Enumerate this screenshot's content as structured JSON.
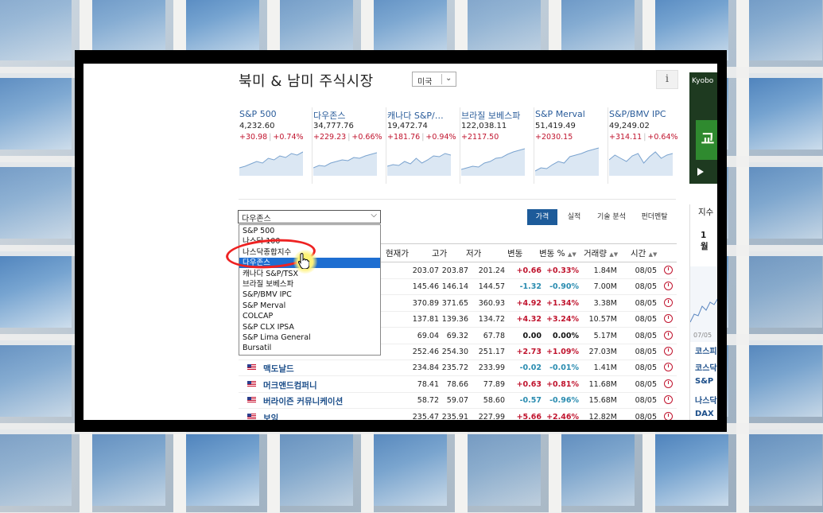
{
  "page": {
    "title": "북미 & 남미 주식시장",
    "region_select": "미국",
    "info_label": "i"
  },
  "indices": [
    {
      "name": "S&P 500",
      "value": "4,232.60",
      "change": "+30.98",
      "pct": "+0.74%"
    },
    {
      "name": "다우존스",
      "value": "34,777.76",
      "change": "+229.23",
      "pct": "+0.66%"
    },
    {
      "name": "캐나다 S&P/…",
      "value": "19,472.74",
      "change": "+181.76",
      "pct": "+0.94%"
    },
    {
      "name": "브라질 보베스파",
      "value": "122,038.11",
      "change": "+2117.50",
      "pct": ""
    },
    {
      "name": "S&P Merval",
      "value": "51,419.49",
      "change": "+2030.15",
      "pct": ""
    },
    {
      "name": "S&P/BMV IPC",
      "value": "49,249.02",
      "change": "+314.11",
      "pct": "+0.64%"
    }
  ],
  "view_tabs": [
    "가격",
    "실적",
    "기술 분석",
    "펀더멘탈"
  ],
  "index_select": {
    "value": "다우존스",
    "options": [
      "S&P 500",
      "나스닥 100",
      "나스닥종합지수",
      "다우존스",
      "캐나다 S&P/TSX",
      "브라질 보베스파",
      "S&P/BMV IPC",
      "S&P Merval",
      "COLCAP",
      "S&P CLX IPSA",
      "S&P Lima General",
      "Bursatil"
    ],
    "selected_index": 3
  },
  "table": {
    "headers": [
      "현재가",
      "고가",
      "저가",
      "변동",
      "변동 %",
      "거래량",
      "시간"
    ],
    "rows": [
      {
        "name": "",
        "last": "203.07",
        "high": "203.87",
        "low": "201.24",
        "chg": "+0.66",
        "pct": "+0.33%",
        "vol": "1.84M",
        "time": "08/05",
        "dir": "up"
      },
      {
        "name": "",
        "last": "145.46",
        "high": "146.14",
        "low": "144.57",
        "chg": "-1.32",
        "pct": "-0.90%",
        "vol": "7.00M",
        "time": "08/05",
        "dir": "down"
      },
      {
        "name": "",
        "last": "370.89",
        "high": "371.65",
        "low": "360.93",
        "chg": "+4.92",
        "pct": "+1.34%",
        "vol": "3.38M",
        "time": "08/05",
        "dir": "up"
      },
      {
        "name": "",
        "last": "137.81",
        "high": "139.36",
        "low": "134.72",
        "chg": "+4.32",
        "pct": "+3.24%",
        "vol": "10.57M",
        "time": "08/05",
        "dir": "up"
      },
      {
        "name": "",
        "last": "69.04",
        "high": "69.32",
        "low": "67.78",
        "chg": "0.00",
        "pct": "0.00%",
        "vol": "5.17M",
        "time": "08/05",
        "dir": "flat"
      },
      {
        "name": "",
        "last": "252.46",
        "high": "254.30",
        "low": "251.17",
        "chg": "+2.73",
        "pct": "+1.09%",
        "vol": "27.03M",
        "time": "08/05",
        "dir": "up"
      },
      {
        "name": "맥도날드",
        "last": "234.84",
        "high": "235.72",
        "low": "233.99",
        "chg": "-0.02",
        "pct": "-0.01%",
        "vol": "1.41M",
        "time": "08/05",
        "dir": "down"
      },
      {
        "name": "머크앤드컴퍼니",
        "last": "78.41",
        "high": "78.66",
        "low": "77.89",
        "chg": "+0.63",
        "pct": "+0.81%",
        "vol": "11.68M",
        "time": "08/05",
        "dir": "up"
      },
      {
        "name": "버라이즌 커뮤니케이션",
        "last": "58.72",
        "high": "59.07",
        "low": "58.60",
        "chg": "-0.57",
        "pct": "-0.96%",
        "vol": "15.68M",
        "time": "08/05",
        "dir": "down"
      },
      {
        "name": "보잉",
        "last": "235.47",
        "high": "235.91",
        "low": "227.99",
        "chg": "+5.66",
        "pct": "+2.46%",
        "vol": "12.82M",
        "time": "08/05",
        "dir": "up"
      }
    ]
  },
  "ad": {
    "text": "Kyobo",
    "glyph": "교"
  },
  "right_panel": {
    "header": "지수",
    "period": "1 월",
    "date_label": "07/05",
    "items": [
      "코스피",
      "코스닥",
      "S&P",
      "나스닥",
      "DAX"
    ]
  },
  "colors": {
    "up": "#c0142e",
    "down": "#2a8cb0",
    "accent": "#1d5b9a",
    "selected": "#1e6ed1"
  }
}
